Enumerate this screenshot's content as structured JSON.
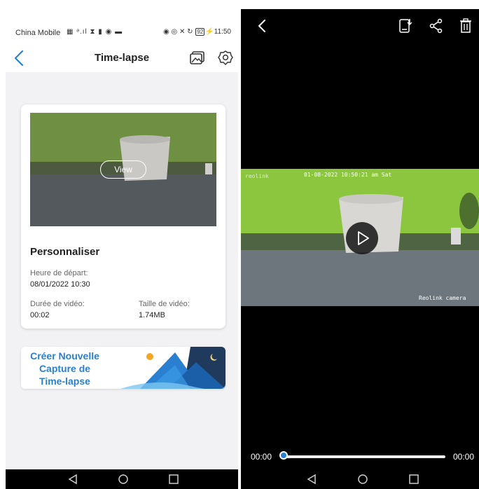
{
  "status_bar": {
    "carrier": "China Mobile",
    "icons_text": "▦ ᵊ.ıl ⧗ ▮ ◉ ▬",
    "right_icons_text": "◉ ◎ ✕ ↻",
    "battery": "92",
    "time": "11:50"
  },
  "left_screen": {
    "title": "Time-lapse",
    "card": {
      "view_label": "View",
      "recording_title": "Personnaliser",
      "start_label": "Heure de départ:",
      "start_value": "08/01/2022 10:30",
      "duration_label": "Durée de vidéo:",
      "duration_value": "00:02",
      "size_label": "Taille de vidéo:",
      "size_value": "1.74MB",
      "thumb_overlay_text": "Reolink camera"
    },
    "banner": {
      "line1": "Créer Nouvelle",
      "line2": "Capture de",
      "line3": "Time-lapse"
    }
  },
  "right_screen": {
    "video_timestamp": "01-08-2022 10:50:21 am Sat",
    "video_brand": "Reolink camera",
    "video_logo": "reolink",
    "current_time": "00:00",
    "total_time": "00:00",
    "progress": 0.0
  },
  "colors": {
    "accent": "#2a7fd0",
    "wall_green": "#8cc63f",
    "background_gray": "#f2f2f4"
  }
}
